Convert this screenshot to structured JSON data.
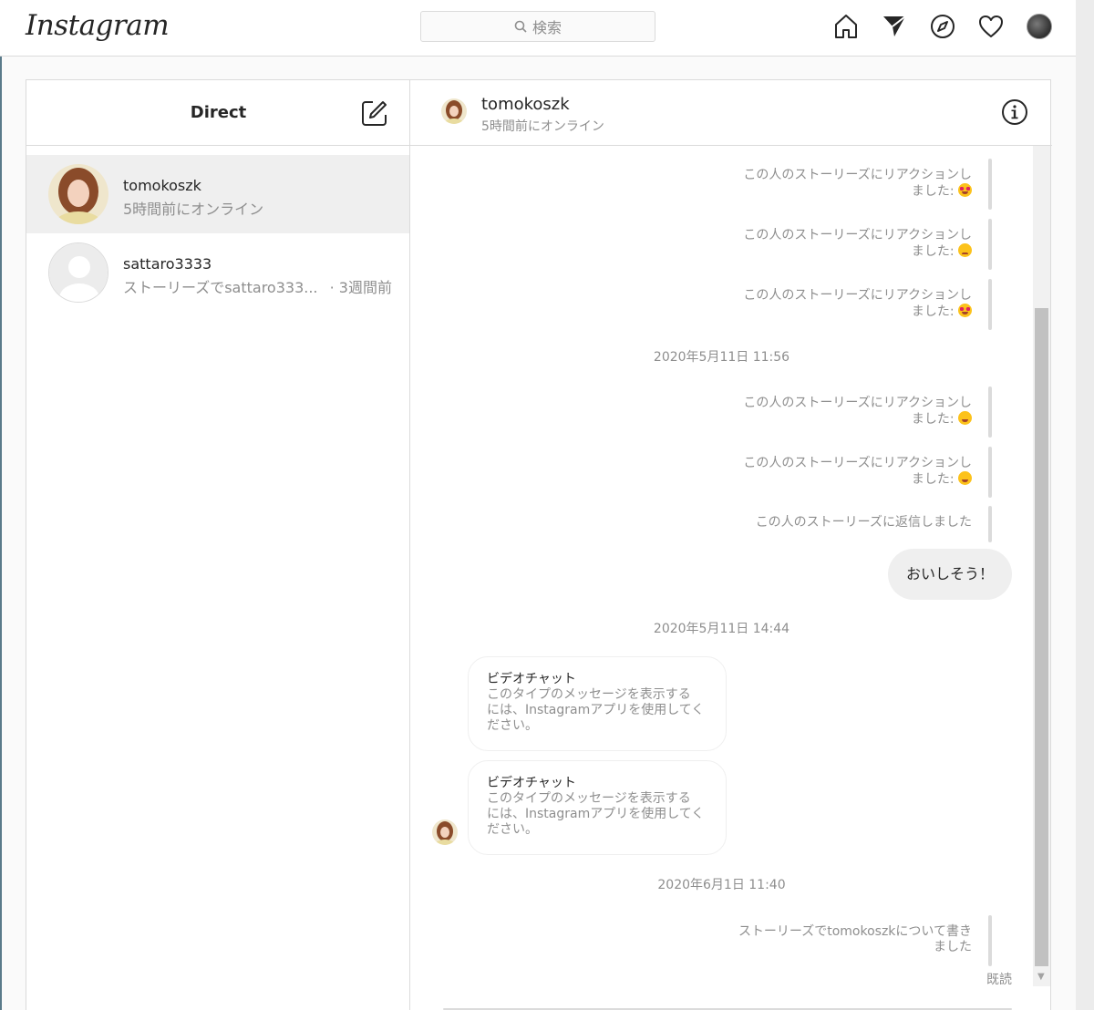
{
  "header": {
    "logo_text": "Instagram",
    "search_placeholder": "検索",
    "icons": [
      "home-icon",
      "direct-icon",
      "explore-icon",
      "activity-heart-icon",
      "profile-avatar"
    ]
  },
  "inbox": {
    "title": "Direct",
    "compose_icon": "compose-icon",
    "conversations": [
      {
        "name": "tomokoszk",
        "subtitle": "5時間前にオンライン",
        "active": true
      },
      {
        "name": "sattaro3333",
        "subtitle": "ストーリーズでsattaro333...",
        "time": "· 3週間前",
        "active": false
      }
    ]
  },
  "thread": {
    "name": "tomokoszk",
    "status": "5時間前にオンライン",
    "info_icon": "info-icon",
    "reaction_text_line1": "この人のストーリーズにリアクションし",
    "reaction_text_line2": "ました:",
    "reactions_group1": [
      "heart-eyes-emoji",
      "sad-emoji",
      "heart-eyes-emoji"
    ],
    "timestamp1": "2020年5月11日 11:56",
    "reactions_group2": [
      "tears-of-joy-emoji",
      "grinning-squint-emoji"
    ],
    "story_reply": "この人のストーリーズに返信しました",
    "my_message": "おいしそう！",
    "timestamp2": "2020年5月11日 14:44",
    "video_cards": [
      {
        "title": "ビデオチャット",
        "line1": "このタイプのメッセージを表示する",
        "line2": "には、Instagramアプリを使用してく",
        "line3": "ださい。"
      },
      {
        "title": "ビデオチャット",
        "line1": "このタイプのメッセージを表示する",
        "line2": "には、Instagramアプリを使用してく",
        "line3": "ださい。"
      }
    ],
    "timestamp3": "2020年6月1日 11:40",
    "mention_line1": "ストーリーズでtomokoszkについて書き",
    "mention_line2": "ました",
    "seen": "既読"
  },
  "colors": {
    "border": "#dbdbdb",
    "muted_text": "#8e8e8e",
    "primary_text": "#262626",
    "active_row": "#efefef"
  }
}
